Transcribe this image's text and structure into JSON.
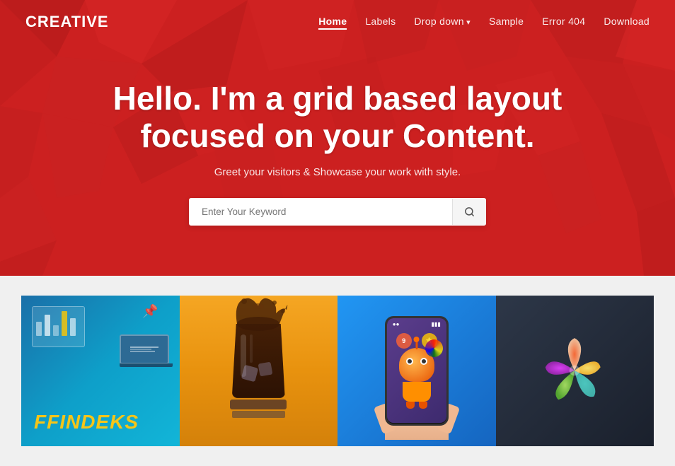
{
  "brand": {
    "name": "CREATIVE"
  },
  "nav": {
    "links": [
      {
        "label": "Home",
        "active": true,
        "dropdown": false
      },
      {
        "label": "Labels",
        "active": false,
        "dropdown": false
      },
      {
        "label": "Drop down",
        "active": false,
        "dropdown": true
      },
      {
        "label": "Sample",
        "active": false,
        "dropdown": false
      },
      {
        "label": "Error 404",
        "active": false,
        "dropdown": false
      },
      {
        "label": "Download",
        "active": false,
        "dropdown": false
      }
    ]
  },
  "hero": {
    "title": "Hello. I'm a grid based layout focused on your Content.",
    "subtitle": "Greet your visitors & Showcase your work with style.",
    "search": {
      "placeholder": "Enter Your Keyword",
      "button_icon": "🔍"
    }
  },
  "grid": {
    "items": [
      {
        "id": "findeks",
        "type": "findeks",
        "label": "FINDEKS"
      },
      {
        "id": "drink",
        "type": "drink",
        "label": "Drink"
      },
      {
        "id": "game",
        "type": "game",
        "label": "Mobile Game"
      },
      {
        "id": "logo",
        "type": "logo",
        "label": "Logo Design"
      }
    ]
  }
}
